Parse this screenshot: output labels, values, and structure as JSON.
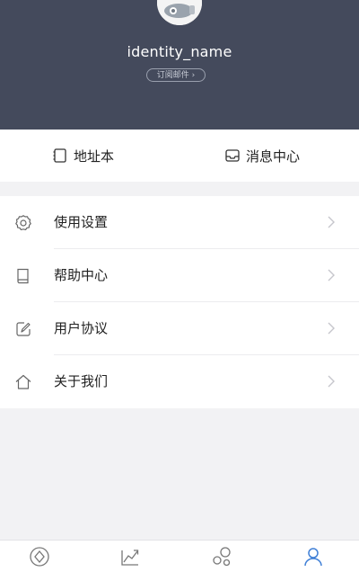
{
  "profile": {
    "name": "identity_name",
    "subscribe_label": "订阅邮件 ›"
  },
  "quick_actions": [
    {
      "label": "地址本",
      "icon": "address-book-icon"
    },
    {
      "label": "消息中心",
      "icon": "inbox-icon"
    }
  ],
  "menu": [
    {
      "label": "使用设置",
      "icon": "gear-icon"
    },
    {
      "label": "帮助中心",
      "icon": "book-icon"
    },
    {
      "label": "用户协议",
      "icon": "pen-icon"
    },
    {
      "label": "关于我们",
      "icon": "home-icon"
    }
  ],
  "tabbar": {
    "tabs": [
      {
        "icon": "diamond-icon",
        "active": false
      },
      {
        "icon": "chart-trend-icon",
        "active": false
      },
      {
        "icon": "circles-icon",
        "active": false
      },
      {
        "icon": "user-icon",
        "active": true
      }
    ]
  },
  "colors": {
    "header_bg": "#444a5c",
    "accent": "#3f7fd6",
    "icon_gray": "#888888"
  }
}
